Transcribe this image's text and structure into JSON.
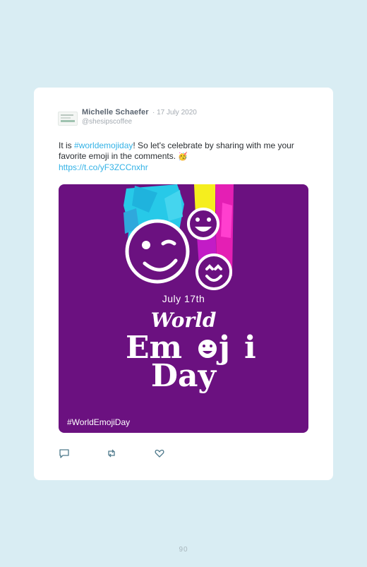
{
  "tweet": {
    "author_name": "Michelle Schaefer",
    "date": "· 17 July 2020",
    "handle": "@shesipscoffee",
    "text_before": "It is ",
    "hashtag_link": "#worldemojiday",
    "text_after": "! So let's celebrate by sharing with me your favorite emoji in the comments. ",
    "party_emoji": "🥳",
    "url": "https://t.co/yF3ZCCnxhr"
  },
  "media": {
    "date_text": "July 17th",
    "title_world": "World",
    "title_emoji_part1": "Em",
    "title_emoji_part2": "j",
    "title_emoji_part3": "i",
    "title_day": "Day",
    "hashtag": "#WorldEmojiDay",
    "background_color": "#6b1180"
  },
  "actions": {
    "reply_icon": "speech-bubble-icon",
    "retweet_icon": "retweet-icon",
    "like_icon": "heart-icon"
  },
  "page": {
    "number": "90"
  },
  "colors": {
    "page_background": "#d9edf3",
    "link": "#33b2e6",
    "icon": "#4f7a8c"
  }
}
